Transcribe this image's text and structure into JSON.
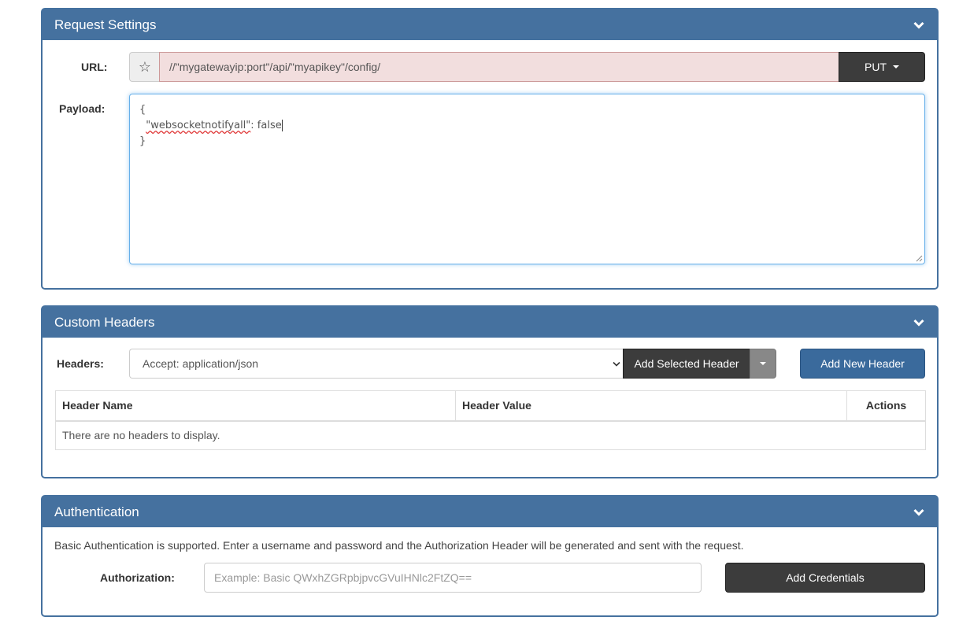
{
  "request_settings": {
    "title": "Request Settings",
    "url_label": "URL:",
    "url_value": "//\"mygatewayip:port\"/api/\"myapikey\"/config/",
    "method": "PUT",
    "payload_label": "Payload:",
    "payload_line1": "{",
    "payload_line2_indent": "  ",
    "payload_key": "\"websocketnotifyall\"",
    "payload_rest": ": false",
    "payload_line3": "}"
  },
  "custom_headers": {
    "title": "Custom Headers",
    "headers_label": "Headers:",
    "selected_header": "Accept: application/json",
    "add_selected_label": "Add Selected Header",
    "add_new_label": "Add New Header",
    "columns": [
      "Header Name",
      "Header Value",
      "Actions"
    ],
    "empty_message": "There are no headers to display."
  },
  "authentication": {
    "title": "Authentication",
    "description": "Basic Authentication is supported. Enter a username and password and the Authorization Header will be generated and sent with the request.",
    "authorization_label": "Authorization:",
    "authorization_placeholder": "Example: Basic QWxhZGRpbjpvcGVuIHNlc2FtZQ==",
    "add_credentials_label": "Add Credentials"
  },
  "icons": {
    "collapse": "chevron-down-icon",
    "favorite": "star-icon",
    "dropdown": "caret-down-icon"
  },
  "colors": {
    "panel_header": "#45719f",
    "url_invalid_bg": "#f2dede",
    "dark_button": "#3c3c3c",
    "primary_button": "#3a6a9c"
  }
}
